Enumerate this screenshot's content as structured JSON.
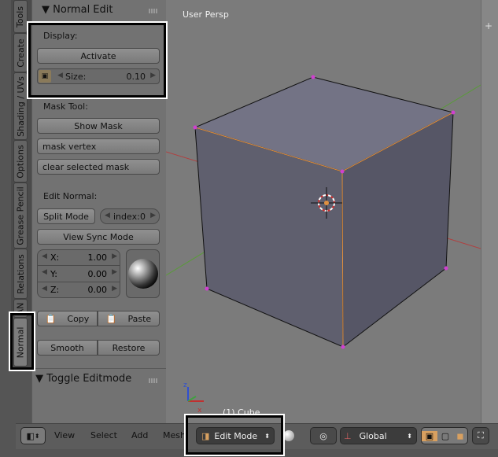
{
  "tabs": [
    "Tools",
    "Create",
    "Shading / UVs",
    "Options",
    "Grease Pencil",
    "Relations",
    "AN",
    "Normal"
  ],
  "panel": {
    "title": "Normal Edit",
    "display_label": "Display:",
    "activate": "Activate",
    "size_label": "Size:",
    "size_value": "0.10",
    "mask_label": "Mask Tool:",
    "show_mask": "Show Mask",
    "mask_vertex": "mask vertex",
    "clear_mask": "clear selected mask",
    "edit_label": "Edit Normal:",
    "split_mode": "Split Mode",
    "index_label": "index:",
    "index_value": "0",
    "view_sync": "View Sync Mode",
    "x_label": "X:",
    "x_value": "1.00",
    "y_label": "Y:",
    "y_value": "0.00",
    "z_label": "Z:",
    "z_value": "0.00",
    "copy": "Copy",
    "paste": "Paste",
    "smooth": "Smooth",
    "restore": "Restore",
    "toggle": "Toggle Editmode"
  },
  "viewport": {
    "title": "User Persp",
    "object": "(1) Cube"
  },
  "bottom": {
    "menus": [
      "View",
      "Select",
      "Add",
      "Mesh"
    ],
    "mode": "Edit Mode",
    "orientation": "Global"
  },
  "colors": {
    "panel": "#727272",
    "viewport": "#7b7b7b",
    "highlight": "#000000",
    "selected_edge": "#f0a040"
  }
}
